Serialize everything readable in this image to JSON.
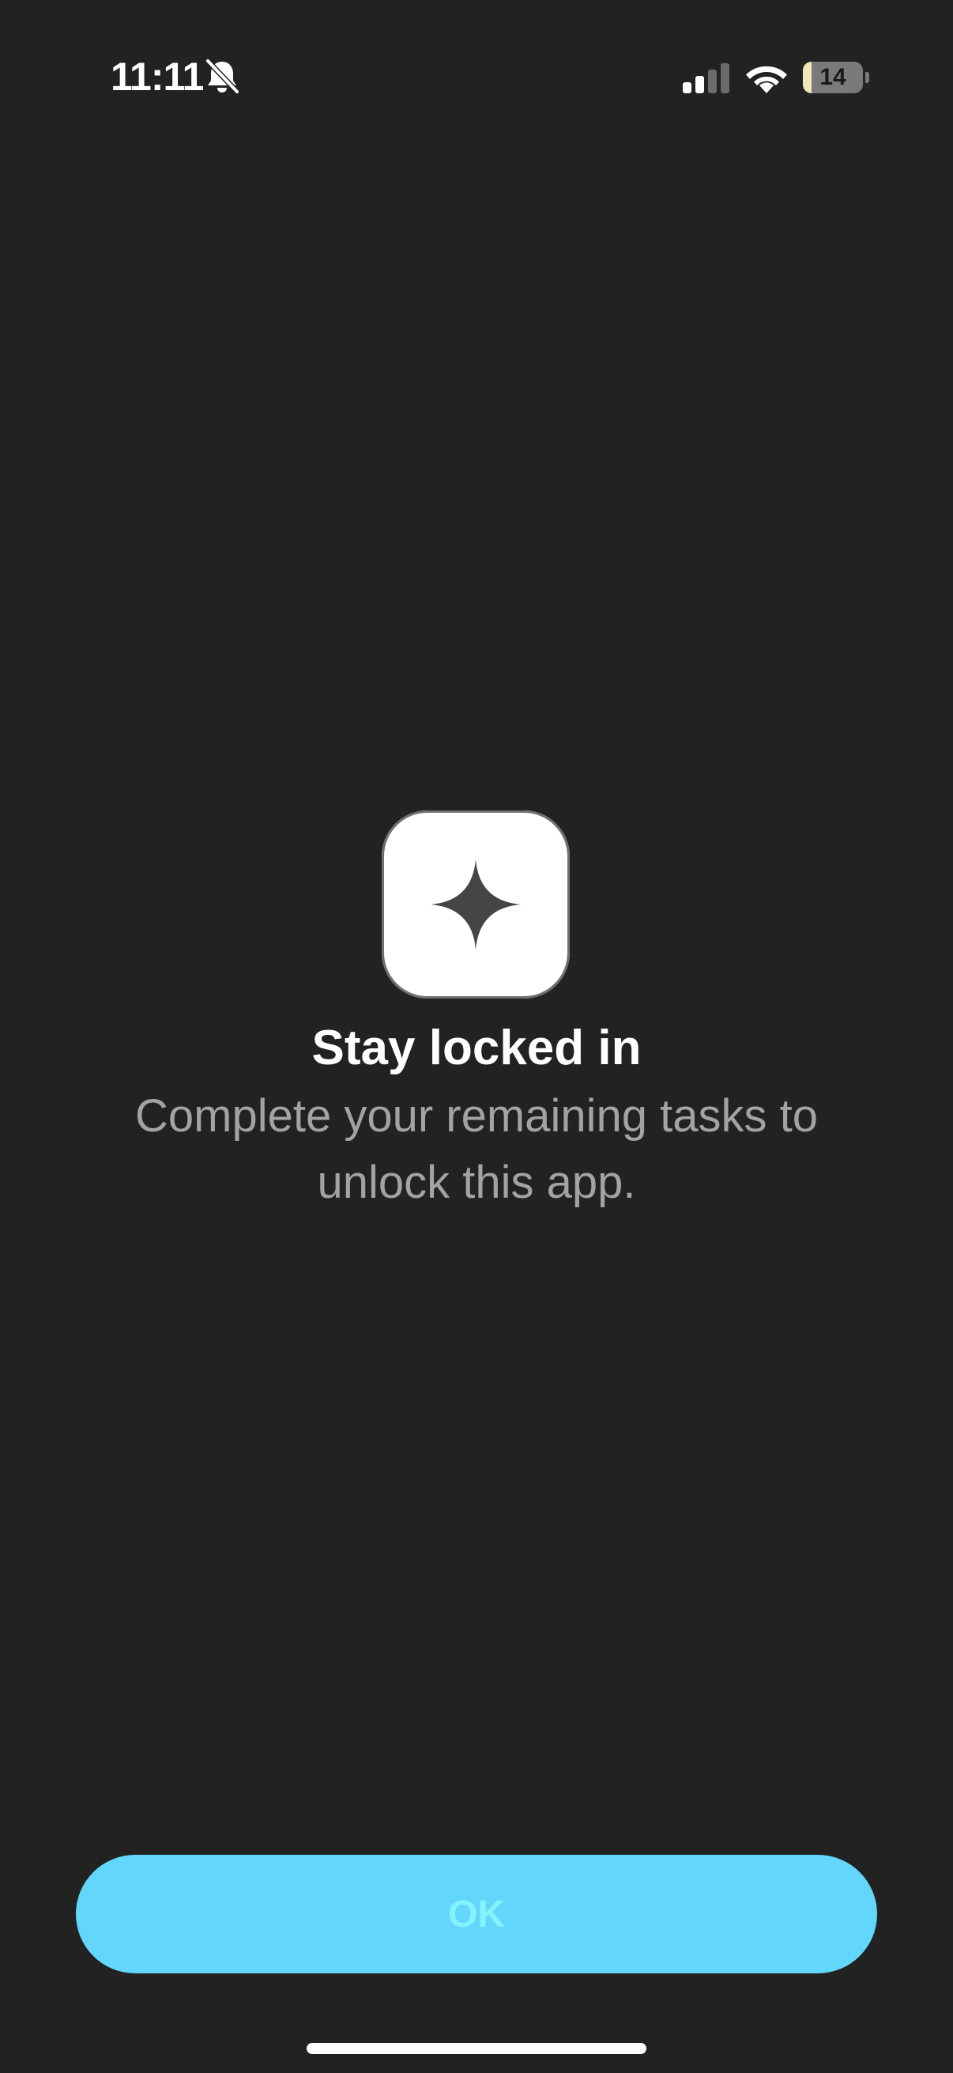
{
  "status_bar": {
    "time": "11:11",
    "silent_icon": "bell-slash-icon",
    "signal_icon": "cellular-signal-icon",
    "signal_bars_active": 2,
    "signal_bars_total": 4,
    "wifi_icon": "wifi-icon",
    "battery_level": "14",
    "battery_fill_percent": 14
  },
  "lock_screen": {
    "app_icon": "sparkle-icon",
    "title": "Stay locked in",
    "message": "Complete your remaining tasks to unlock this app."
  },
  "actions": {
    "ok_label": "OK"
  },
  "colors": {
    "background": "#222222",
    "accent": "#63d6fb",
    "button_text": "#84f3ff",
    "secondary_text": "#a3a3a3",
    "battery_fill": "#f1e7b8"
  }
}
